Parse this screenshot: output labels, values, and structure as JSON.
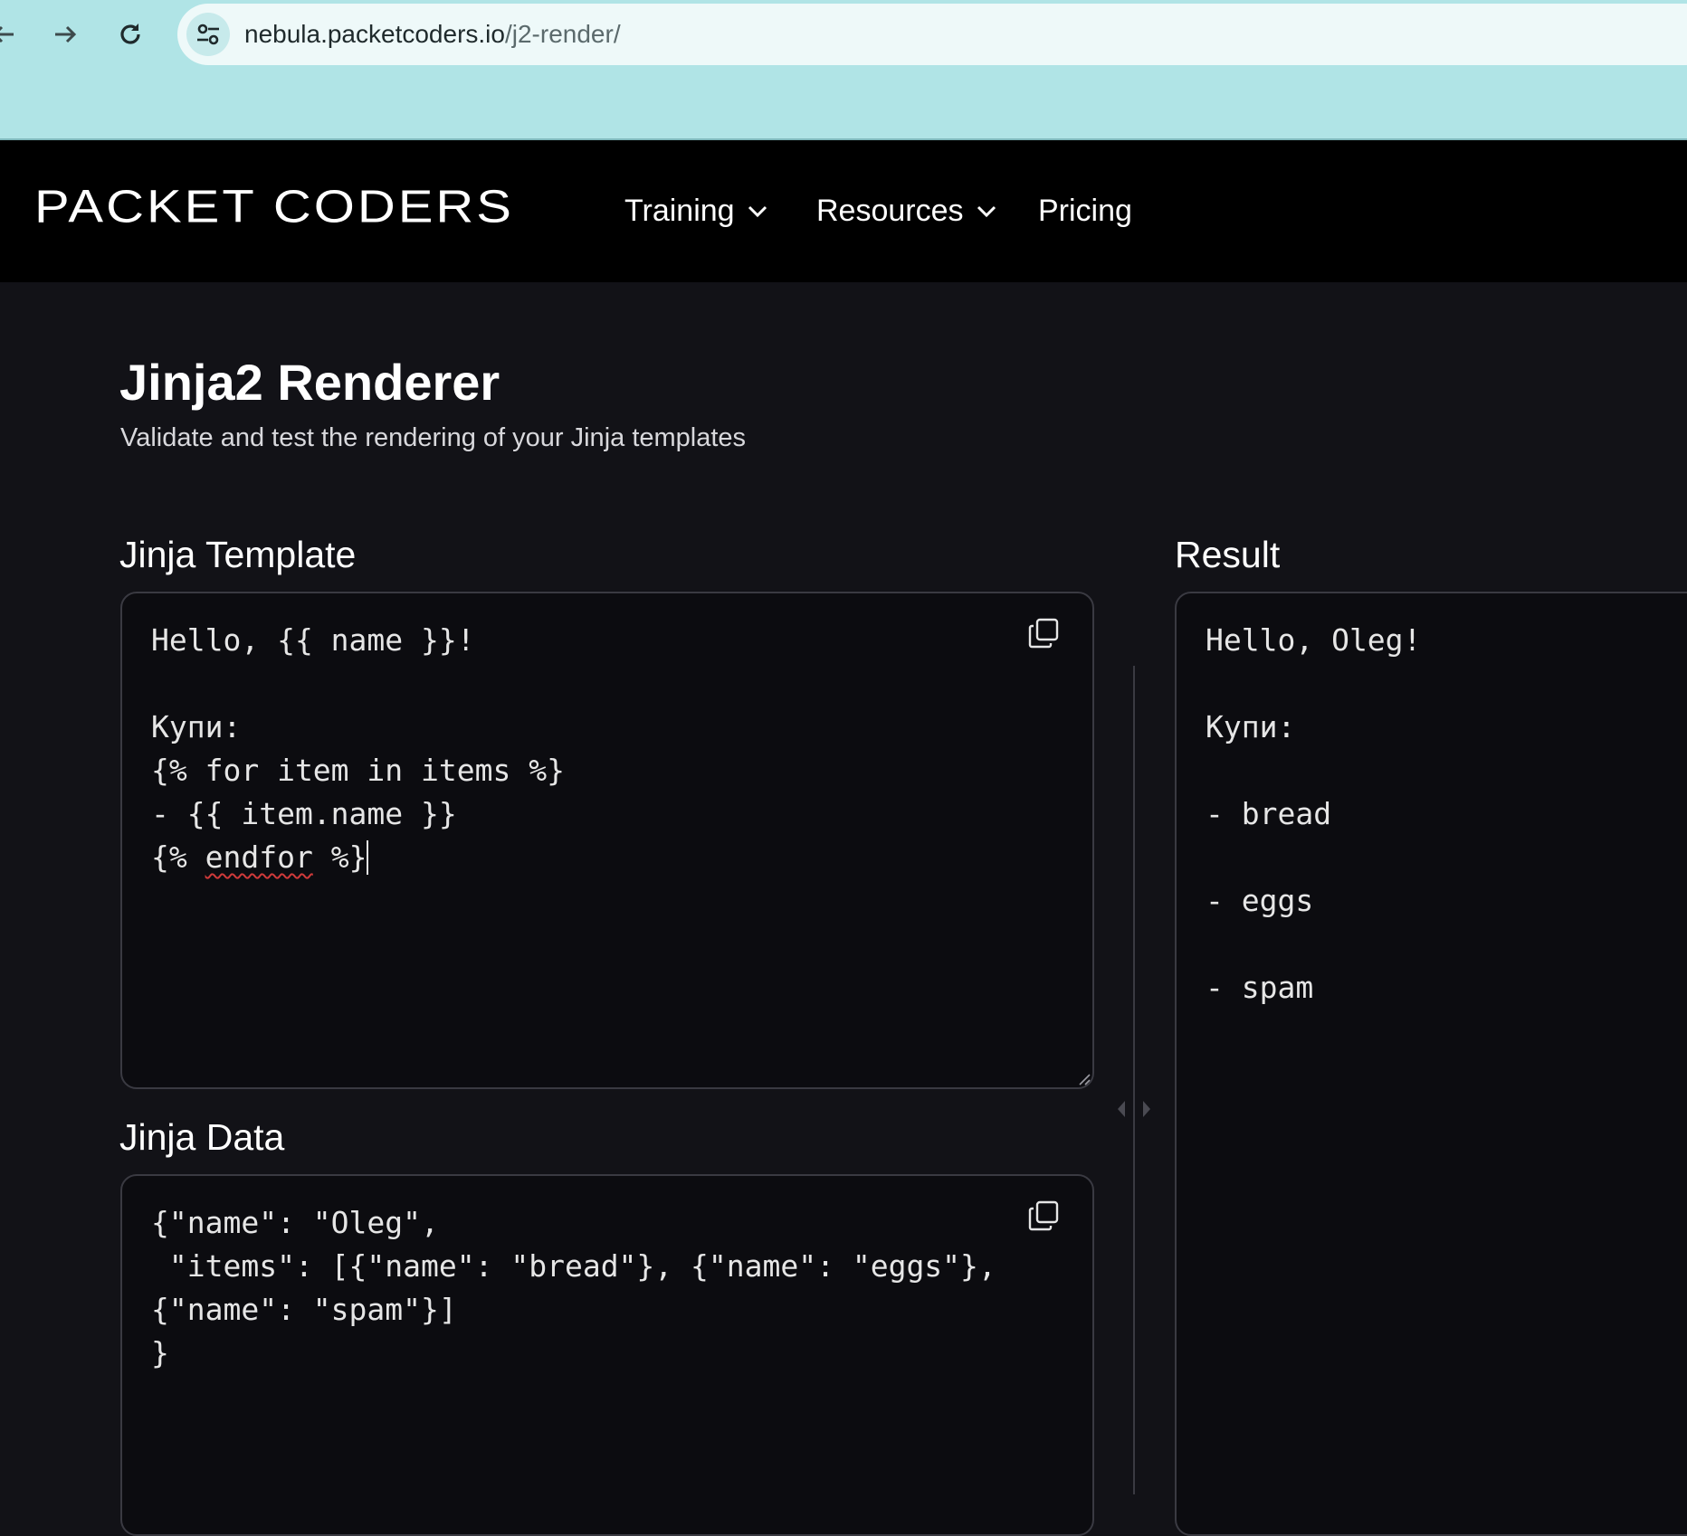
{
  "browser": {
    "back_icon": "arrow-left-icon",
    "forward_icon": "arrow-right-icon",
    "reload_icon": "reload-icon",
    "site_info_icon": "tune-icon",
    "url_host": "nebula.packetcoders.io",
    "url_path": "/j2-render/"
  },
  "header": {
    "logo": "PACKET CODERS",
    "nav": [
      {
        "label": "Training",
        "icon": "chevron-down-icon"
      },
      {
        "label": "Resources",
        "icon": "chevron-down-icon"
      },
      {
        "label": "Pricing"
      }
    ]
  },
  "page": {
    "title": "Jinja2 Renderer",
    "subtitle": "Validate and test the rendering of your Jinja templates"
  },
  "template_editor": {
    "label": "Jinja Template",
    "lines": [
      "Hello, {{ name }}!",
      "",
      "Купи:",
      "{% for item in items %}",
      "- {{ item.name }}"
    ],
    "last_line_prefix": "{% ",
    "last_line_misspelled": "endfor",
    "last_line_suffix": " %}",
    "copy_icon": "copy-icon"
  },
  "data_editor": {
    "label": "Jinja Data",
    "lines": [
      "{\"name\": \"Oleg\",",
      " \"items\": [{\"name\": \"bread\"}, {\"name\": \"eggs\"},",
      "{\"name\": \"spam\"}]",
      "}"
    ],
    "copy_icon": "copy-icon"
  },
  "result": {
    "label": "Result",
    "lines": [
      "Hello, Oleg!",
      "",
      "Купи:",
      "",
      "- bread",
      "",
      "- eggs",
      "",
      "- spam"
    ]
  },
  "colors": {
    "browser_bar": "#b0e4e6",
    "header_bg": "#000000",
    "page_bg": "#121217",
    "editor_border": "#3a3a42"
  }
}
